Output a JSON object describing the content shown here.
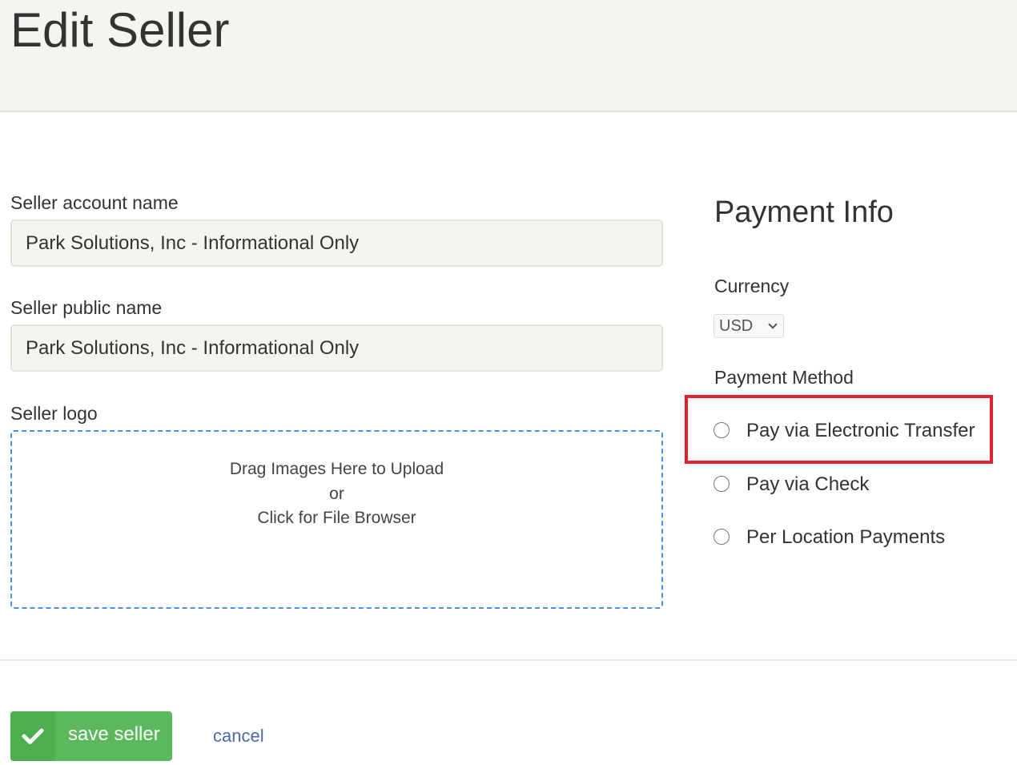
{
  "header": {
    "title": "Edit Seller"
  },
  "form": {
    "account_name": {
      "label": "Seller account name",
      "value": "Park Solutions, Inc - Informational Only"
    },
    "public_name": {
      "label": "Seller public name",
      "value": "Park Solutions, Inc - Informational Only"
    },
    "logo": {
      "label": "Seller logo",
      "drop_lines": [
        "Drag Images Here to Upload",
        "or",
        "Click for File Browser"
      ]
    }
  },
  "payment": {
    "title": "Payment Info",
    "currency_label": "Currency",
    "currency_selected": "USD",
    "method_label": "Payment Method",
    "methods": [
      {
        "label": "Pay via Electronic Transfer",
        "selected": false
      },
      {
        "label": "Pay via Check",
        "selected": false
      },
      {
        "label": "Per Location Payments",
        "selected": false
      }
    ]
  },
  "actions": {
    "save_label": "save seller",
    "cancel_label": "cancel"
  },
  "icons": {
    "save": "check-icon",
    "currency_dropdown": "chevron-down-icon"
  },
  "colors": {
    "header_bg": "#f5f5f0",
    "save_button": "#5cb85c",
    "drop_zone_border": "#4a90e2",
    "highlight": "#e0202a",
    "link": "#4a6aa8"
  }
}
